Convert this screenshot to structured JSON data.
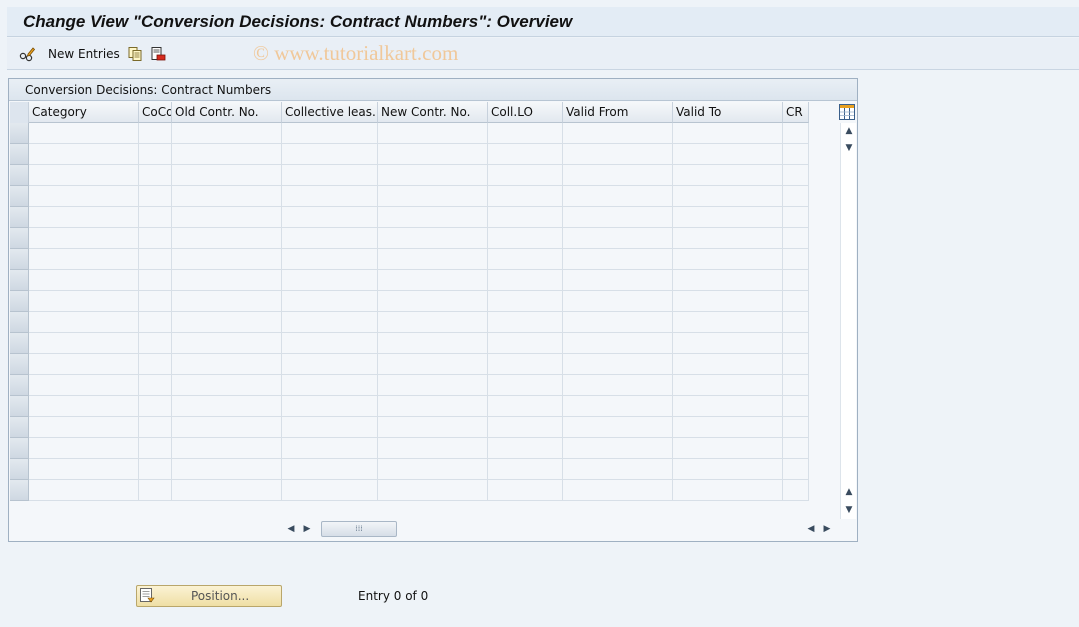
{
  "window": {
    "title": "Change View \"Conversion Decisions: Contract Numbers\": Overview"
  },
  "toolbar": {
    "change_icon": "pencil-glasses-icon",
    "new_entries_label": "New Entries",
    "copy_icon": "copy-icon",
    "delete_icon": "delete-icon",
    "watermark": "© www.tutorialkart.com"
  },
  "table": {
    "title": "Conversion Decisions: Contract Numbers",
    "columns": [
      {
        "label": "Category"
      },
      {
        "label": "CoCd"
      },
      {
        "label": "Old Contr. No."
      },
      {
        "label": "Collective leas..."
      },
      {
        "label": "New Contr. No."
      },
      {
        "label": "Coll.LO"
      },
      {
        "label": "Valid From"
      },
      {
        "label": "Valid To"
      },
      {
        "label": "CR"
      }
    ],
    "rows": [],
    "column_settings_icon": "column-settings-icon"
  },
  "footer": {
    "position_button_label": "Position...",
    "entry_text": "Entry 0 of 0"
  },
  "colors": {
    "background": "#eef3f8",
    "header": "#e3ecf5",
    "button": "#efdfa5",
    "watermark": "#f0c89a"
  }
}
